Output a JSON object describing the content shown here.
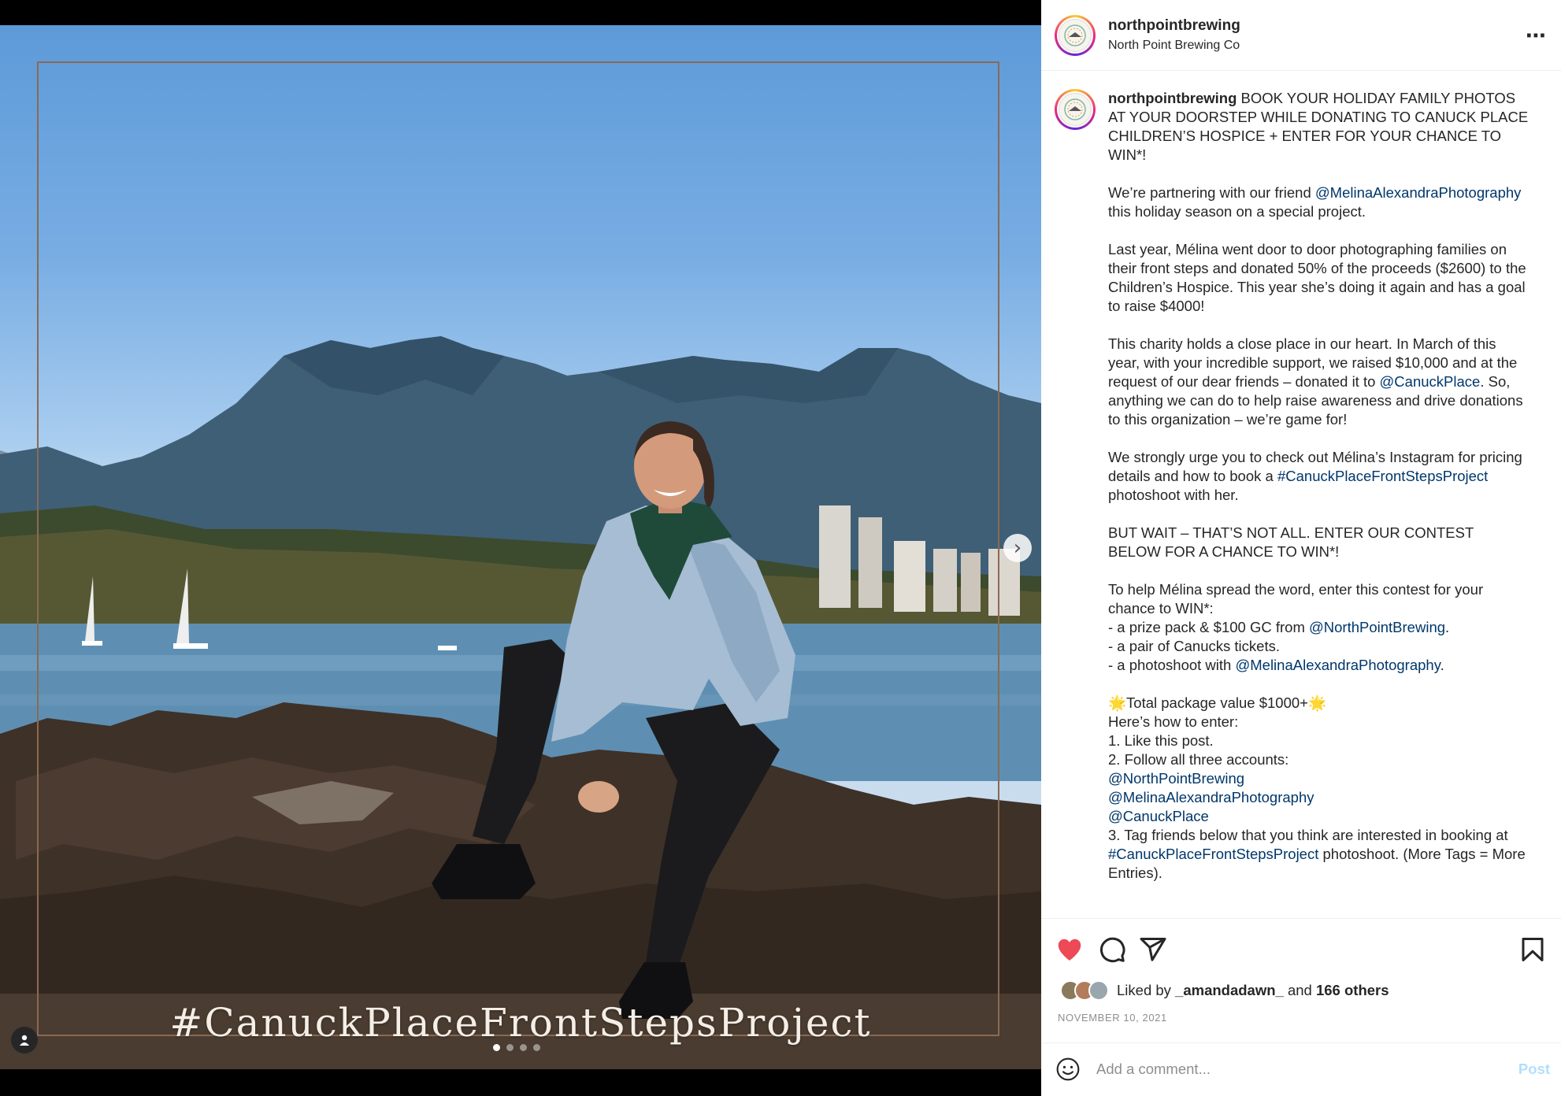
{
  "post": {
    "username": "northpointbrewing",
    "display_name": "North Point Brewing Co",
    "more_icon": "⋯",
    "image_overlay_text": "#CanuckPlaceFrontStepsProject",
    "next_icon": "›",
    "carousel_dots": 4,
    "carousel_active": 0
  },
  "caption": {
    "username": "northpointbrewing",
    "p1": " BOOK YOUR HOLIDAY FAMILY PHOTOS AT YOUR DOORSTEP WHILE DONATING TO CANUCK PLACE CHILDREN’S HOSPICE + ENTER FOR YOUR CHANCE TO WIN*!",
    "p2a": "We’re partnering with our friend ",
    "mention_melina": "@MelinaAlexandraPhotography",
    "p2b": " this holiday season on a special project.",
    "p3": "Last year, Mélina went door to door photographing families on their front steps and donated 50% of the proceeds ($2600) to the Children’s Hospice. This year she’s doing it again and has a goal to raise $4000!",
    "p4a": "This charity holds a close place in our heart. In March of this year, with your incredible support, we raised $10,000 and at the request of our dear friends – donated it to ",
    "mention_canuck": "@CanuckPlace",
    "p4b": ". So, anything we can do to help raise awareness and drive donations to this organization – we’re game for!",
    "p5a": "We strongly urge you to check out Mélina’s Instagram for pricing details and how to book a ",
    "hashtag": "#CanuckPlaceFrontStepsProject",
    "p5b": " photoshoot with her.",
    "p6": "BUT WAIT – THAT’S NOT ALL. ENTER OUR CONTEST BELOW FOR A CHANCE TO WIN*!",
    "p7": "To help Mélina spread the word, enter this contest for your chance to WIN*:",
    "prize1a": "- a prize pack & $100 GC from ",
    "mention_npb": "@NorthPointBrewing",
    "prize1b": ".",
    "prize2": "- a pair of Canucks tickets.",
    "prize3a": "- a photoshoot with ",
    "prize3b": ".",
    "total": "🌟Total package value $1000+🌟",
    "how": "Here’s how to enter:",
    "step1": "1. Like this post.",
    "step2": "2. Follow all three accounts:",
    "step3a": "3. Tag friends below that you think are interested in booking at ",
    "step3b": " photoshoot. (More Tags = More Entries)."
  },
  "actions": {
    "liked_by_prefix": "Liked by ",
    "liked_by_user": "_amandadawn_",
    "liked_by_mid": " and ",
    "liked_by_count": "166 others",
    "date": "NOVEMBER 10, 2021",
    "comment_placeholder": "Add a comment...",
    "post_label": "Post",
    "accent_like": "#ed4956",
    "link_color": "#00376b"
  }
}
